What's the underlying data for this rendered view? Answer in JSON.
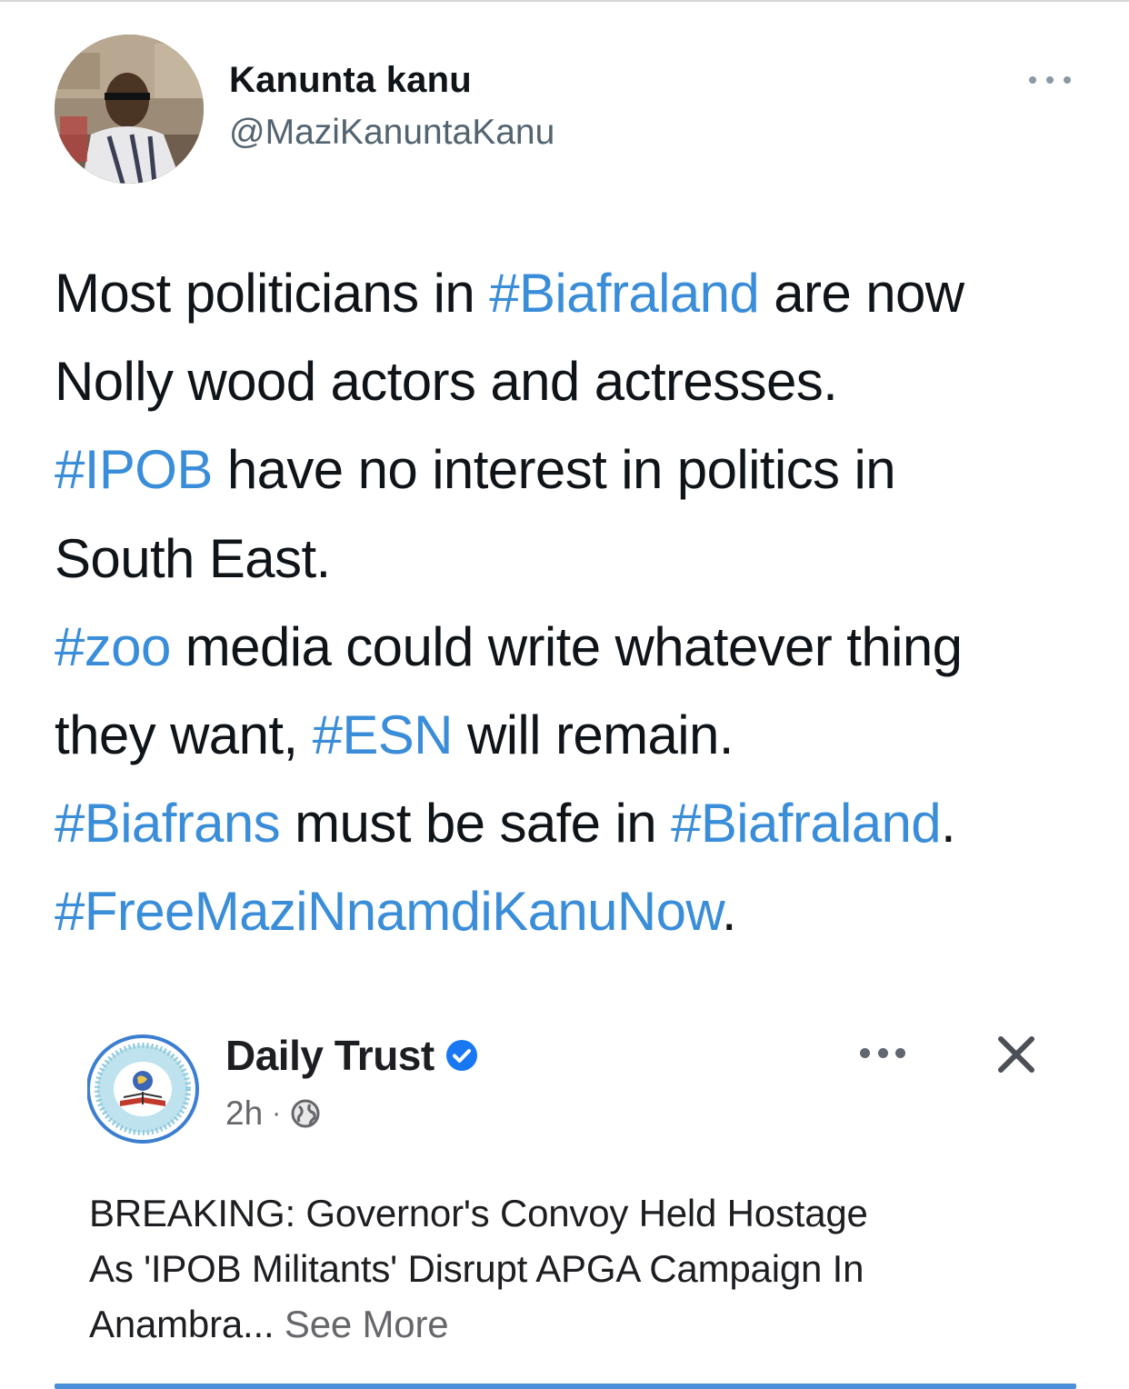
{
  "tweet": {
    "author_name": "Kanunta kanu",
    "author_handle": "@MaziKanuntaKanu",
    "more_icon": "ellipsis-icon",
    "lines": [
      [
        {
          "t": "Most politicians in ",
          "tag": false
        },
        {
          "t": "#Biafraland",
          "tag": true
        },
        {
          "t": " are now",
          "tag": false
        }
      ],
      [
        {
          "t": "Nolly wood actors and actresses.",
          "tag": false
        }
      ],
      [
        {
          "t": "#IPOB",
          "tag": true
        },
        {
          "t": " have no interest in politics in",
          "tag": false
        }
      ],
      [
        {
          "t": "South East.",
          "tag": false
        }
      ],
      [
        {
          "t": "#zoo",
          "tag": true
        },
        {
          "t": " media could write whatever thing",
          "tag": false
        }
      ],
      [
        {
          "t": "they want, ",
          "tag": false
        },
        {
          "t": "#ESN",
          "tag": true
        },
        {
          "t": " will remain.",
          "tag": false
        }
      ],
      [
        {
          "t": "#Biafrans",
          "tag": true
        },
        {
          "t": " must be safe in ",
          "tag": false
        },
        {
          "t": "#Biafraland",
          "tag": true
        },
        {
          "t": ".",
          "tag": false
        }
      ],
      [
        {
          "t": "#FreeMaziNnamdiKanuNow",
          "tag": true
        },
        {
          "t": ".",
          "tag": false
        }
      ]
    ],
    "hashtag_color": "#3a8dd8"
  },
  "embedded_post": {
    "page_name": "Daily Trust",
    "time": "2h",
    "separator": "·",
    "audience_icon": "globe-icon",
    "verified_icon": "verified-badge-icon",
    "more_icon": "ellipsis-icon",
    "close_icon": "close-icon",
    "text_lines": [
      "BREAKING: Governor's Convoy Held Hostage",
      "As 'IPOB Militants' Disrupt APGA Campaign In",
      "Anambra..."
    ],
    "see_more": "See More",
    "accent_color": "#4a90d9"
  }
}
